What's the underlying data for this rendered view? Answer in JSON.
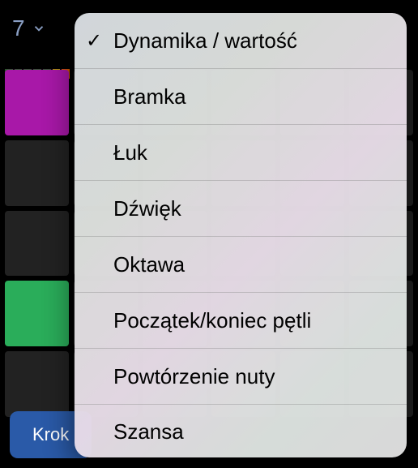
{
  "header": {
    "value": "7"
  },
  "bottom": {
    "button_label": "Krok"
  },
  "menu": {
    "items": [
      {
        "label": "Dynamika / wartość",
        "selected": true
      },
      {
        "label": "Bramka",
        "selected": false
      },
      {
        "label": "Łuk",
        "selected": false
      },
      {
        "label": "Dźwięk",
        "selected": false
      },
      {
        "label": "Oktawa",
        "selected": false
      },
      {
        "label": "Początek/koniec pętli",
        "selected": false
      },
      {
        "label": "Powtórzenie nuty",
        "selected": false
      },
      {
        "label": "Szansa",
        "selected": false
      }
    ]
  }
}
